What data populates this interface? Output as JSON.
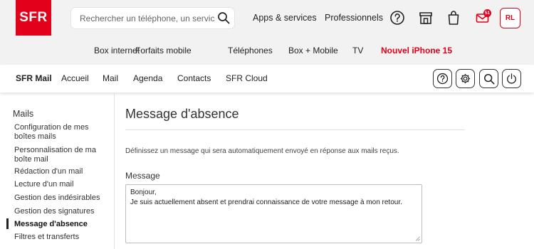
{
  "header": {
    "logo_text": "SFR",
    "search_placeholder": "Rechercher un téléphone, un service, ...",
    "links": [
      "Apps & services",
      "Professionnels"
    ],
    "notifications_badge": "51",
    "avatar_initials": "RL",
    "icons": [
      "help-icon",
      "store-icon",
      "bag-icon",
      "mail-icon"
    ]
  },
  "main_nav": {
    "items": [
      "Box internet",
      "Forfaits mobile",
      "Téléphones",
      "Box + Mobile",
      "TV"
    ],
    "highlight": "Nouvel iPhone 15"
  },
  "mail_bar": {
    "brand": "SFR Mail",
    "tabs": [
      "Accueil",
      "Mail",
      "Agenda",
      "Contacts",
      "SFR Cloud"
    ],
    "tools": [
      "help-icon",
      "settings-icon",
      "search-icon",
      "power-icon"
    ]
  },
  "sidebar": {
    "title": "Mails",
    "items": [
      "Configuration de mes boîtes mails",
      "Personnalisation de ma boîte mail",
      "Rédaction d'un mail",
      "Lecture d'un mail",
      "Gestion des indésirables",
      "Gestion des signatures",
      "Message d'absence",
      "Filtres et transferts"
    ],
    "active_index": 6
  },
  "content": {
    "title": "Message d'absence",
    "description": "Définissez un message qui sera automatiquement envoyé en réponse aux mails reçus.",
    "message_label": "Message",
    "message_lines": [
      "Bonjour,",
      "Je suis actuellement absent et prendrai connaissance de votre message à mon retour."
    ]
  },
  "colors": {
    "brand": "#e2001a",
    "header_bg": "#f2f2f2"
  }
}
